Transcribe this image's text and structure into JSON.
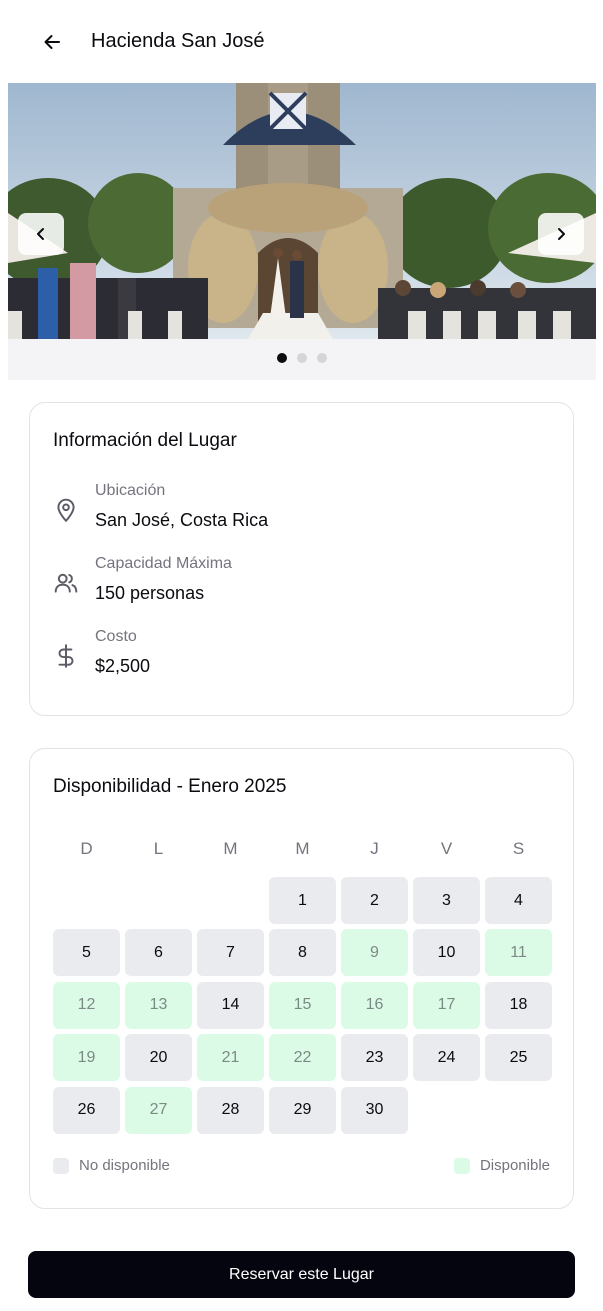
{
  "header": {
    "title": "Hacienda San José",
    "back_icon": "arrow-left-icon"
  },
  "gallery": {
    "image_description_icon": "venue-photo",
    "prev_icon": "chevron-left-icon",
    "next_icon": "chevron-right-icon",
    "slide_count": 3,
    "active_slide": 1
  },
  "info": {
    "title": "Información del Lugar",
    "location": {
      "icon": "map-pin-icon",
      "label": "Ubicación",
      "value": "San José, Costa Rica"
    },
    "capacity": {
      "icon": "users-icon",
      "label": "Capacidad Máxima",
      "value": "150 personas"
    },
    "cost": {
      "icon": "dollar-icon",
      "label": "Costo",
      "value": "$2,500"
    }
  },
  "calendar": {
    "title": "Disponibilidad - Enero 2025",
    "weekdays": [
      "D",
      "L",
      "M",
      "M",
      "J",
      "V",
      "S"
    ],
    "days": [
      {
        "n": "1",
        "status": "unavailable"
      },
      {
        "n": "2",
        "status": "unavailable"
      },
      {
        "n": "3",
        "status": "unavailable"
      },
      {
        "n": "4",
        "status": "unavailable"
      },
      {
        "n": "5",
        "status": "unavailable"
      },
      {
        "n": "6",
        "status": "unavailable"
      },
      {
        "n": "7",
        "status": "unavailable"
      },
      {
        "n": "8",
        "status": "unavailable"
      },
      {
        "n": "9",
        "status": "available"
      },
      {
        "n": "10",
        "status": "unavailable"
      },
      {
        "n": "11",
        "status": "available"
      },
      {
        "n": "12",
        "status": "available"
      },
      {
        "n": "13",
        "status": "available"
      },
      {
        "n": "14",
        "status": "unavailable"
      },
      {
        "n": "15",
        "status": "available"
      },
      {
        "n": "16",
        "status": "available"
      },
      {
        "n": "17",
        "status": "available"
      },
      {
        "n": "18",
        "status": "unavailable"
      },
      {
        "n": "19",
        "status": "available"
      },
      {
        "n": "20",
        "status": "unavailable"
      },
      {
        "n": "21",
        "status": "available"
      },
      {
        "n": "22",
        "status": "available"
      },
      {
        "n": "23",
        "status": "unavailable"
      },
      {
        "n": "24",
        "status": "unavailable"
      },
      {
        "n": "25",
        "status": "unavailable"
      },
      {
        "n": "26",
        "status": "unavailable"
      },
      {
        "n": "27",
        "status": "available"
      },
      {
        "n": "28",
        "status": "unavailable"
      },
      {
        "n": "29",
        "status": "unavailable"
      },
      {
        "n": "30",
        "status": "unavailable"
      }
    ],
    "legend": {
      "unavailable_label": "No disponible",
      "available_label": "Disponible",
      "unavailable_color": "#eaebee",
      "available_color": "#dcfbe6"
    }
  },
  "cta": {
    "label": "Reservar este Lugar",
    "color": "#05050f"
  }
}
